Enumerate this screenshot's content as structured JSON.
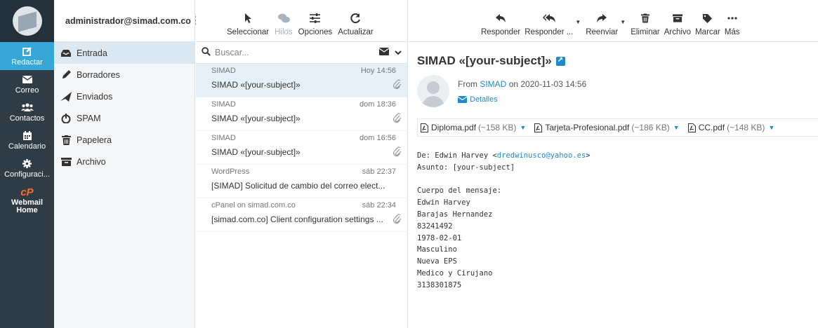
{
  "rail": {
    "items": [
      {
        "label": "Redactar",
        "icon": "compose-icon"
      },
      {
        "label": "Correo",
        "icon": "mail-icon"
      },
      {
        "label": "Contactos",
        "icon": "contacts-icon"
      },
      {
        "label": "Calendario",
        "icon": "calendar-icon"
      },
      {
        "label": "Configuraci...",
        "icon": "gear-icon"
      }
    ],
    "webmail_line1": "Webmail",
    "webmail_line2": "Home",
    "active_color": "#37a7d8"
  },
  "account": {
    "email": "administrador@simad.com.co"
  },
  "folders": [
    {
      "label": "Entrada",
      "icon": "inbox-icon"
    },
    {
      "label": "Borradores",
      "icon": "pencil-icon"
    },
    {
      "label": "Enviados",
      "icon": "send-icon"
    },
    {
      "label": "SPAM",
      "icon": "spam-icon"
    },
    {
      "label": "Papelera",
      "icon": "trash-icon"
    },
    {
      "label": "Archivo",
      "icon": "archive-icon"
    }
  ],
  "list_toolbar": {
    "select": "Seleccionar",
    "threads": "Hilos",
    "options": "Opciones",
    "refresh": "Actualizar"
  },
  "search": {
    "placeholder": "Buscar..."
  },
  "messages": [
    {
      "from": "SIMAD",
      "date": "Hoy 14:56",
      "subject": "SIMAD «[your-subject]»",
      "attachment": true
    },
    {
      "from": "SIMAD",
      "date": "dom 18:36",
      "subject": "SIMAD «[your-subject]»",
      "attachment": true
    },
    {
      "from": "SIMAD",
      "date": "dom 16:56",
      "subject": "SIMAD «[your-subject]»",
      "attachment": true
    },
    {
      "from": "WordPress",
      "date": "sáb 22:37",
      "subject": "[SIMAD] Solicitud de cambio del correo elect...",
      "attachment": false
    },
    {
      "from": "cPanel on simad.com.co",
      "date": "sáb 22:34",
      "subject": "[simad.com.co] Client configuration settings ...",
      "attachment": true
    }
  ],
  "preview_toolbar": {
    "reply": "Responder",
    "reply_all": "Responder ...",
    "forward": "Reenviar",
    "delete": "Eliminar",
    "archive": "Archivo",
    "mark": "Marcar",
    "more": "Más"
  },
  "email": {
    "subject": "SIMAD «[your-subject]»",
    "from_prefix": "From",
    "from_name": "SIMAD",
    "date_text": "on 2020-11-03 14:56",
    "details": "Detalles",
    "attachments": [
      {
        "name": "Diploma.pdf",
        "size": "(~158 KB)"
      },
      {
        "name": "Tarjeta-Profesional.pdf",
        "size": "(~186 KB)"
      },
      {
        "name": "CC.pdf",
        "size": "(~148 KB)"
      }
    ],
    "body_de_prefix": "De: Edwin Harvey <",
    "body_de_email": "dredwinusco@yahoo.es",
    "body_de_suffix": ">",
    "body_lines": [
      "Asunto: [your-subject]",
      "",
      "Cuerpo del mensaje:",
      "Edwin Harvey",
      "Barajas Hernandez",
      "83241492",
      "1978-02-01",
      "Masculino",
      "Nueva EPS",
      "Medico y Cirujano",
      "3138301875"
    ]
  },
  "colors": {
    "link": "#1f8ac9",
    "rail_bg": "#2f3b45",
    "selected_row": "#e5f0f8"
  }
}
